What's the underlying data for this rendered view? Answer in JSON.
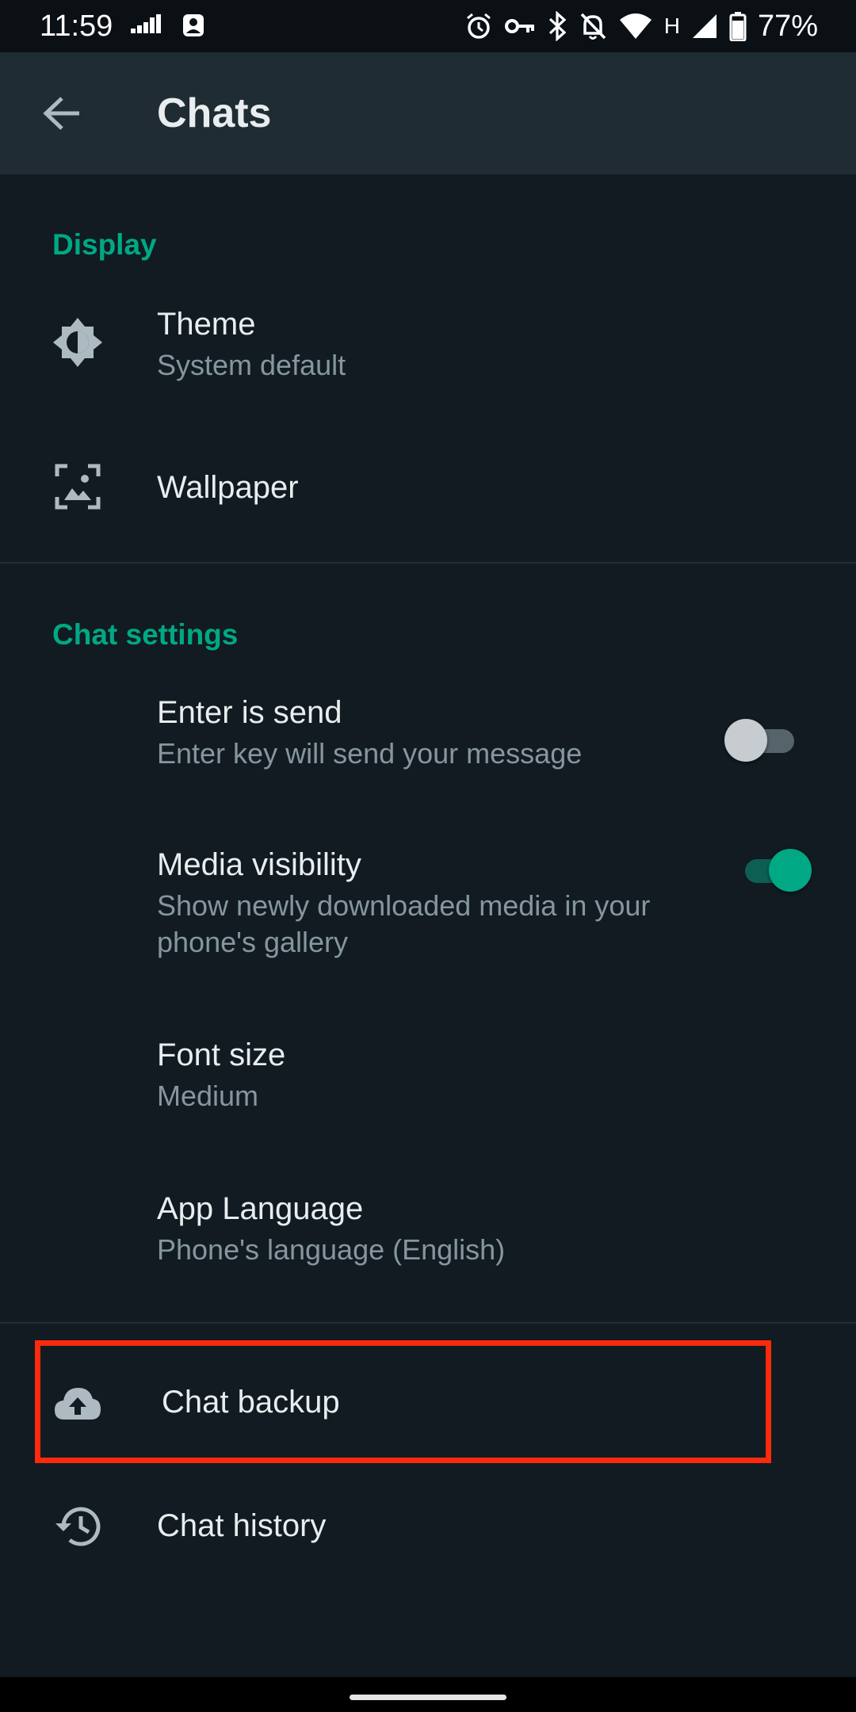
{
  "status_bar": {
    "time": "11:59",
    "network_type": "H",
    "battery": "77%",
    "icons": [
      "activity-icon",
      "vpn-profile-icon",
      "alarm-icon",
      "vpn-key-icon",
      "bluetooth-icon",
      "notifications-off-icon",
      "wifi-icon",
      "signal-icon",
      "battery-icon"
    ]
  },
  "app_bar": {
    "title": "Chats",
    "back_icon": "arrow-back-icon",
    "background": "#202c33"
  },
  "sections": {
    "display": {
      "header": "Display"
    },
    "chat_settings": {
      "header": "Chat settings"
    }
  },
  "settings": {
    "theme": {
      "title": "Theme",
      "subtitle": "System default",
      "icon": "brightness-icon"
    },
    "wallpaper": {
      "title": "Wallpaper",
      "icon": "wallpaper-icon"
    },
    "enter_is_send": {
      "title": "Enter is send",
      "subtitle": "Enter key will send your message",
      "enabled": false
    },
    "media_visibility": {
      "title": "Media visibility",
      "subtitle_line1": "Show newly downloaded media in your",
      "subtitle_line2": "phone's gallery",
      "enabled": true
    },
    "font_size": {
      "title": "Font size",
      "subtitle": "Medium"
    },
    "app_language": {
      "title": "App Language",
      "subtitle": "Phone's language (English)"
    },
    "chat_backup": {
      "title": "Chat backup",
      "icon": "cloud-upload-icon",
      "highlighted": true
    },
    "chat_history": {
      "title": "Chat history",
      "icon": "history-icon"
    }
  },
  "colors": {
    "background": "#111b21",
    "accent": "#00a884",
    "primary_text": "#e9edef",
    "secondary_text": "#8696a0",
    "highlight": "#ff2a0e"
  }
}
